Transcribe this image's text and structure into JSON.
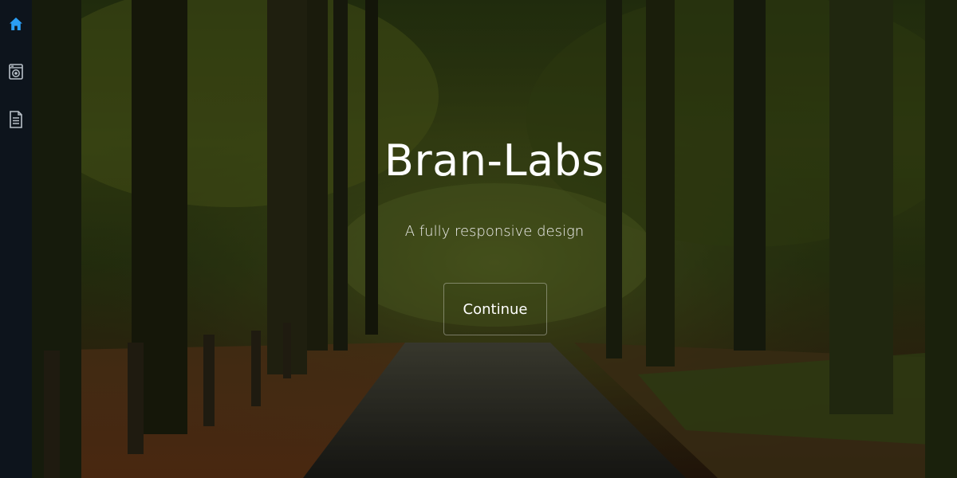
{
  "sidebar": {
    "items": [
      {
        "icon": "home-icon",
        "color": "#2a9df4",
        "active": true
      },
      {
        "icon": "washing-machine-icon",
        "color": "#b8c0c8",
        "active": false
      },
      {
        "icon": "document-icon",
        "color": "#b8c0c8",
        "active": false
      }
    ]
  },
  "hero": {
    "title": "Bran-Labs",
    "subtitle": "A fully responsive design",
    "button_label": "Continue"
  }
}
